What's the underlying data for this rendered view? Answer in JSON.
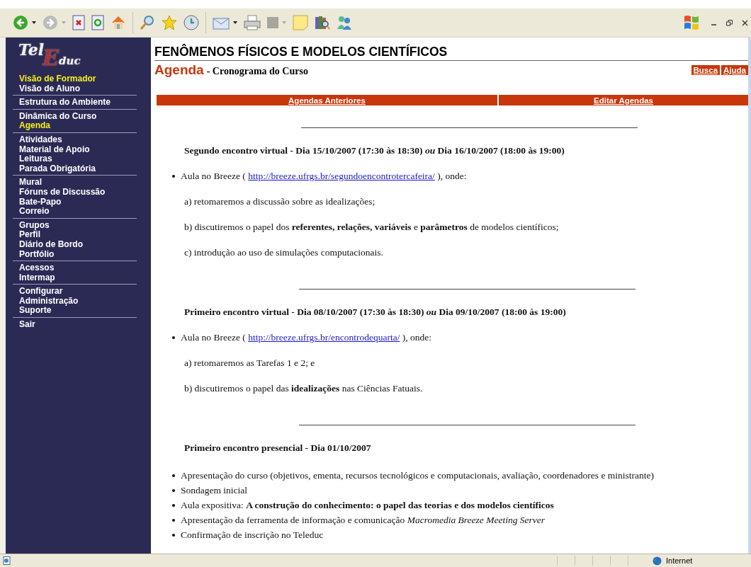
{
  "logo": {
    "parts": [
      "Tel",
      "E",
      "duc"
    ]
  },
  "sidebar": {
    "groups": [
      [
        {
          "label": "Visão de Formador",
          "selected": true
        },
        {
          "label": "Visão de Aluno",
          "selected": false
        }
      ],
      [
        {
          "label": "Estrutura do Ambiente",
          "selected": false
        }
      ],
      [
        {
          "label": "Dinâmica do Curso",
          "selected": false
        },
        {
          "label": "Agenda",
          "selected": true
        }
      ],
      [
        {
          "label": "Atividades",
          "selected": false
        },
        {
          "label": "Material de Apoio",
          "selected": false
        },
        {
          "label": "Leituras",
          "selected": false
        },
        {
          "label": "Parada Obrigatória",
          "selected": false
        }
      ],
      [
        {
          "label": "Mural",
          "selected": false
        },
        {
          "label": "Fóruns de Discussão",
          "selected": false
        },
        {
          "label": "Bate-Papo",
          "selected": false
        },
        {
          "label": "Correio",
          "selected": false
        }
      ],
      [
        {
          "label": "Grupos",
          "selected": false
        },
        {
          "label": "Perfil",
          "selected": false
        },
        {
          "label": "Diário de Bordo",
          "selected": false
        },
        {
          "label": "Portfólio",
          "selected": false
        }
      ],
      [
        {
          "label": "Acessos",
          "selected": false
        },
        {
          "label": "Intermap",
          "selected": false
        }
      ],
      [
        {
          "label": "Configurar",
          "selected": false
        },
        {
          "label": "Administração",
          "selected": false
        },
        {
          "label": "Suporte",
          "selected": false
        }
      ],
      [
        {
          "label": "Sair",
          "selected": false
        }
      ]
    ]
  },
  "header": {
    "course_title": "FENÔMENOS FÍSICOS E MODELOS CIENTÍFICOS",
    "page_title": "Agenda",
    "subtitle": "- Cronograma do Curso",
    "buttons": [
      "Busca",
      "Ajuda"
    ]
  },
  "action_bar": [
    "Agendas Anteriores",
    "Editar Agendas"
  ],
  "sections": [
    {
      "heading": "Segundo encontro virtual - Dia 15/10/2007 (17:30 às 18:30) *ou* Dia 16/10/2007 (18:00 às 19:00)",
      "items": [
        {
          "kind": "link-bullet",
          "before": "Aula no Breeze ( ",
          "link": "http://breeze.ufrgs.br/segundoencontrotercafeira/",
          "after": " ), onde:"
        },
        {
          "kind": "para",
          "text": "a) retomaremos a discussão sobre as idealizações;"
        },
        {
          "kind": "para",
          "text": "b) discutiremos o papel dos **referentes, relações, variáveis** e **parâmetros** de modelos científicos;"
        },
        {
          "kind": "para",
          "text": "c) introdução ao uso de simulações computacionais."
        }
      ]
    },
    {
      "heading": "Primeiro encontro virtual - Dia 08/10/2007 (17:30 às 18:30) *ou* Dia 09/10/2007 (18:00 às 19:00)",
      "items": [
        {
          "kind": "link-bullet",
          "before": "Aula no Breeze ( ",
          "link": "http://breeze.ufrgs.br/encontrodequarta/",
          "after": " ), onde:"
        },
        {
          "kind": "para",
          "text": "a) retomaremos as Tarefas 1 e 2; e"
        },
        {
          "kind": "para",
          "text": "b) discutiremos o papel das **idealizações** nas Ciências Fatuais."
        }
      ]
    },
    {
      "heading": "Primeiro encontro presencial - Dia 01/10/2007",
      "items": [
        {
          "kind": "bullet",
          "text": "Apresentação do curso (objetivos, ementa, recursos tecnológicos e computacionais, avaliação, coordenadores e ministrante)"
        },
        {
          "kind": "bullet",
          "text": "Sondagem inicial"
        },
        {
          "kind": "bullet",
          "text": "Aula expositiva: **A construção do conhecimento: o papel das teorias e dos modelos científicos**"
        },
        {
          "kind": "bullet",
          "text": "Apresentação da ferramenta de informação e comunicação *Macromedia Breeze Meeting Server*"
        },
        {
          "kind": "bullet",
          "text": "Confirmação de inscrição no Teleduc"
        }
      ]
    }
  ],
  "status_bar": {
    "zone": "Internet"
  }
}
